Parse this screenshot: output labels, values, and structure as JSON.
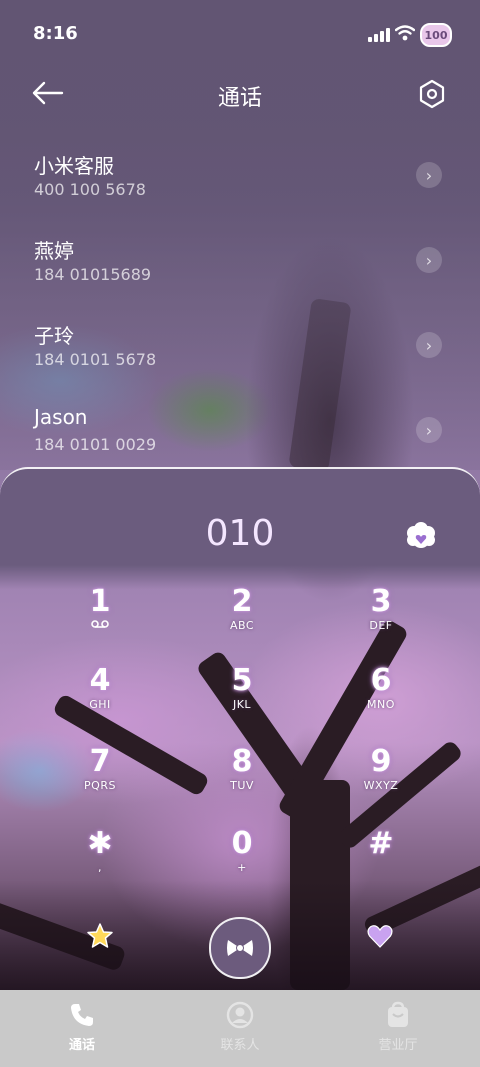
{
  "status_bar": {
    "time": "8:16",
    "battery": "100"
  },
  "header": {
    "title": "通话"
  },
  "calls": [
    {
      "name": "小米客服",
      "number": "400 100 5678"
    },
    {
      "name": "燕婷",
      "number": "184 01015689"
    },
    {
      "name": "子玲",
      "number": "184 0101 5678"
    },
    {
      "name": "Jason",
      "number": "184 0101 0029"
    }
  ],
  "dialpad": {
    "display": "010",
    "keys": [
      {
        "digit": "1",
        "letters": ""
      },
      {
        "digit": "2",
        "letters": "ABC"
      },
      {
        "digit": "3",
        "letters": "DEF"
      },
      {
        "digit": "4",
        "letters": "GHI"
      },
      {
        "digit": "5",
        "letters": "JKL"
      },
      {
        "digit": "6",
        "letters": "MNO"
      },
      {
        "digit": "7",
        "letters": "PQRS"
      },
      {
        "digit": "8",
        "letters": "TUV"
      },
      {
        "digit": "9",
        "letters": "WXYZ"
      },
      {
        "digit": "✱",
        "letters": ","
      },
      {
        "digit": "0",
        "letters": "+"
      },
      {
        "digit": "#",
        "letters": ""
      }
    ]
  },
  "nav": [
    {
      "label": "通话",
      "icon": "phone-icon",
      "active": true
    },
    {
      "label": "联系人",
      "icon": "contact-icon",
      "active": false
    },
    {
      "label": "营业厅",
      "icon": "store-icon",
      "active": false
    }
  ],
  "colors": {
    "accent": "#6b5c7e",
    "nav_bg": "#c9c9c9",
    "display_text": "#f4e6ff"
  }
}
